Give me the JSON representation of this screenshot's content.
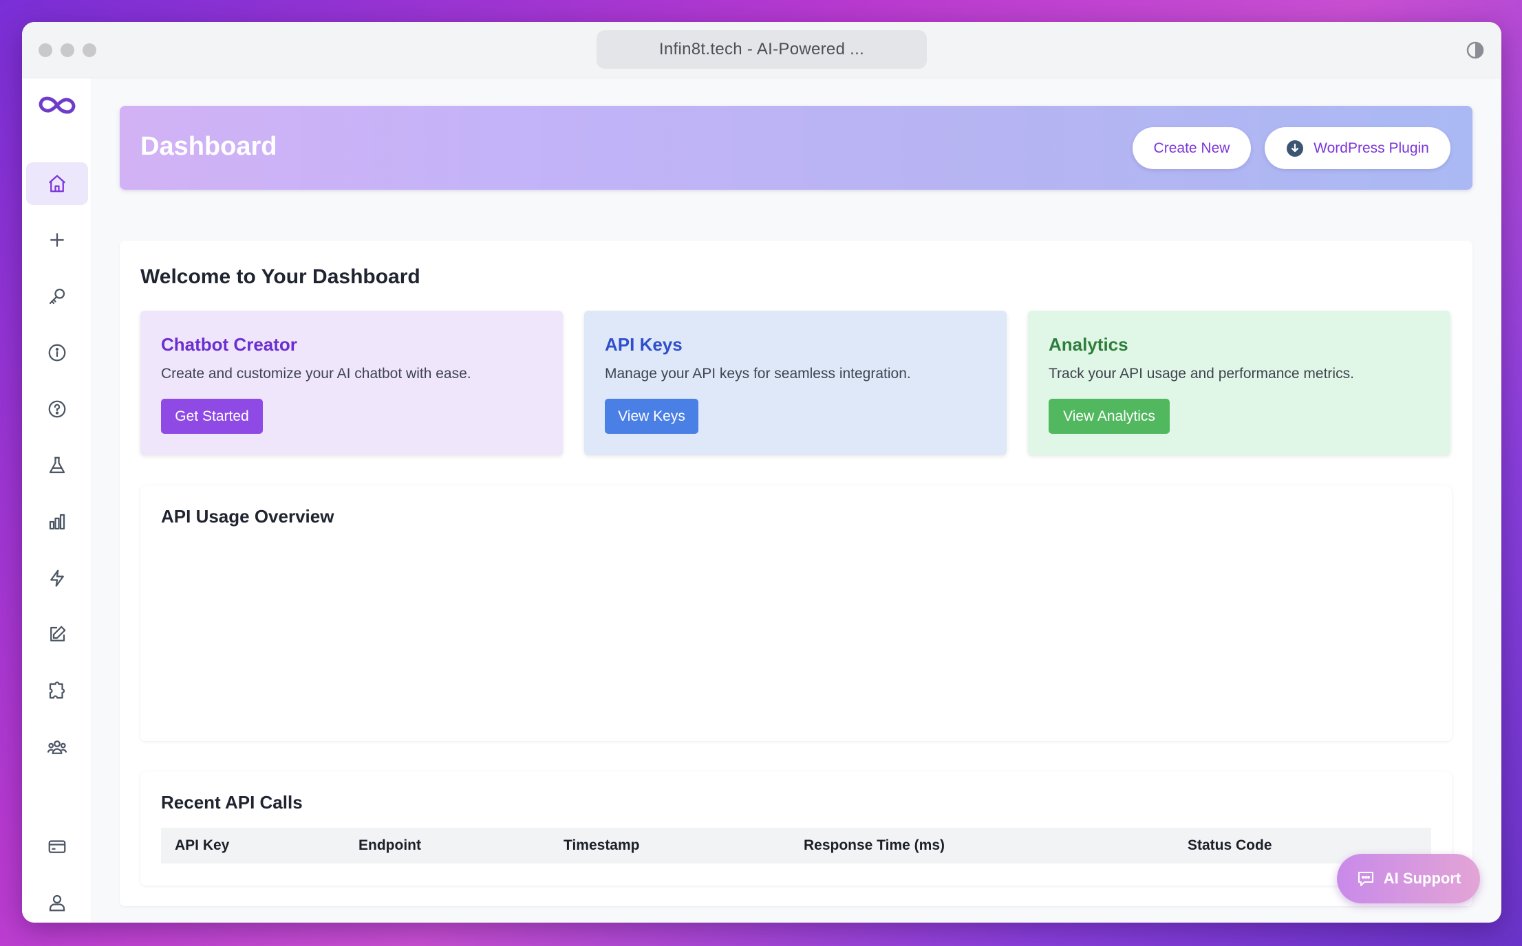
{
  "browser": {
    "tab_title": "Infin8t.tech - AI-Powered ..."
  },
  "header": {
    "title": "Dashboard",
    "create_label": "Create New",
    "wp_label": "WordPress Plugin"
  },
  "welcome": {
    "title": "Welcome to Your Dashboard"
  },
  "cards": [
    {
      "title": "Chatbot Creator",
      "desc": "Create and customize your AI chatbot with ease.",
      "button": "Get Started"
    },
    {
      "title": "API Keys",
      "desc": "Manage your API keys for seamless integration.",
      "button": "View Keys"
    },
    {
      "title": "Analytics",
      "desc": "Track your API usage and performance metrics.",
      "button": "View Analytics"
    }
  ],
  "usage": {
    "title": "API Usage Overview"
  },
  "recent_calls": {
    "title": "Recent API Calls",
    "columns": [
      "API Key",
      "Endpoint",
      "Timestamp",
      "Response Time (ms)",
      "Status Code"
    ]
  },
  "support": {
    "label": "AI Support"
  },
  "sidebar": {
    "items": [
      "home-icon",
      "plus-icon",
      "key-icon",
      "info-icon",
      "help-icon",
      "flask-icon",
      "bar-chart-icon",
      "lightning-icon",
      "edit-icon",
      "puzzle-icon",
      "users-icon",
      "credit-card-icon",
      "user-icon"
    ]
  },
  "colors": {
    "accent": "#7b35d9",
    "blue": "#4a7fe6",
    "green": "#51b85f"
  }
}
